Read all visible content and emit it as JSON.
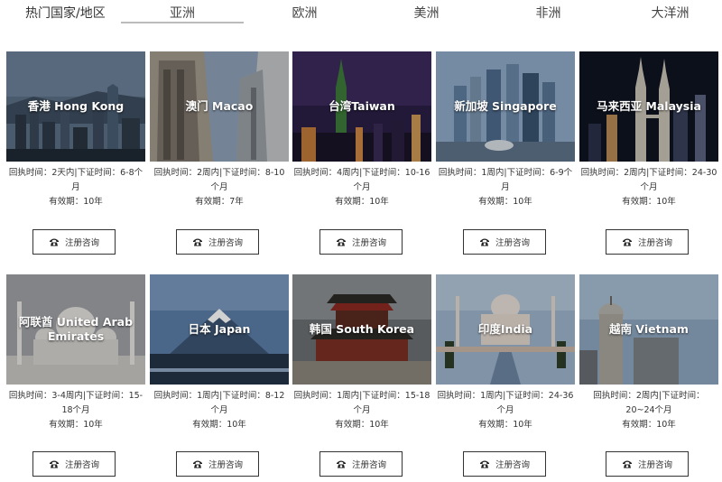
{
  "section_title": "热门国家/地区",
  "tabs": [
    {
      "label": "亚洲",
      "active": true
    },
    {
      "label": "欧洲",
      "active": false
    },
    {
      "label": "美洲",
      "active": false
    },
    {
      "label": "非洲",
      "active": false
    },
    {
      "label": "大洋洲",
      "active": false
    }
  ],
  "consult_button_label": "注册咨询",
  "consult_icon": "phone-icon",
  "cards": [
    {
      "name": "香港 Hong Kong",
      "info": "回执时间：2天内|下证时间：6-8个月",
      "validity": "有效期：10年",
      "scene": "skyline-harbor"
    },
    {
      "name": "澳门 Macao",
      "info": "回执时间：2周内|下证时间：8-10个月",
      "validity": "有效期：7年",
      "scene": "architecture"
    },
    {
      "name": "台湾Taiwan",
      "info": "回执时间：4周内|下证时间：10-16个月",
      "validity": "有效期：10年",
      "scene": "tower-night"
    },
    {
      "name": "新加坡 Singapore",
      "info": "回执时间：1周内|下证时间：6-9个月",
      "validity": "有效期：10年",
      "scene": "skyline-day"
    },
    {
      "name": "马来西亚 Malaysia",
      "info": "回执时间：2周内|下证时间：24-30个月",
      "validity": "有效期：10年",
      "scene": "twin-towers"
    },
    {
      "name": "阿联酋 United Arab Emirates",
      "info": "回执时间：3-4周内|下证时间：15-18个月",
      "validity": "有效期：10年",
      "scene": "mosque"
    },
    {
      "name": "日本 Japan",
      "info": "回执时间：1周内|下证时间：8-12个月",
      "validity": "有效期：10年",
      "scene": "mountain"
    },
    {
      "name": "韩国 South Korea",
      "info": "回执时间：1周内|下证时间：15-18个月",
      "validity": "有效期：10年",
      "scene": "palace"
    },
    {
      "name": "印度India",
      "info": "回执时间：1周内|下证时间：24-36个月",
      "validity": "有效期：10年",
      "scene": "taj"
    },
    {
      "name": "越南 Vietnam",
      "info": "回执时间：2周内|下证时间：20~24个月",
      "validity": "有效期：10年",
      "scene": "cathedral"
    }
  ]
}
